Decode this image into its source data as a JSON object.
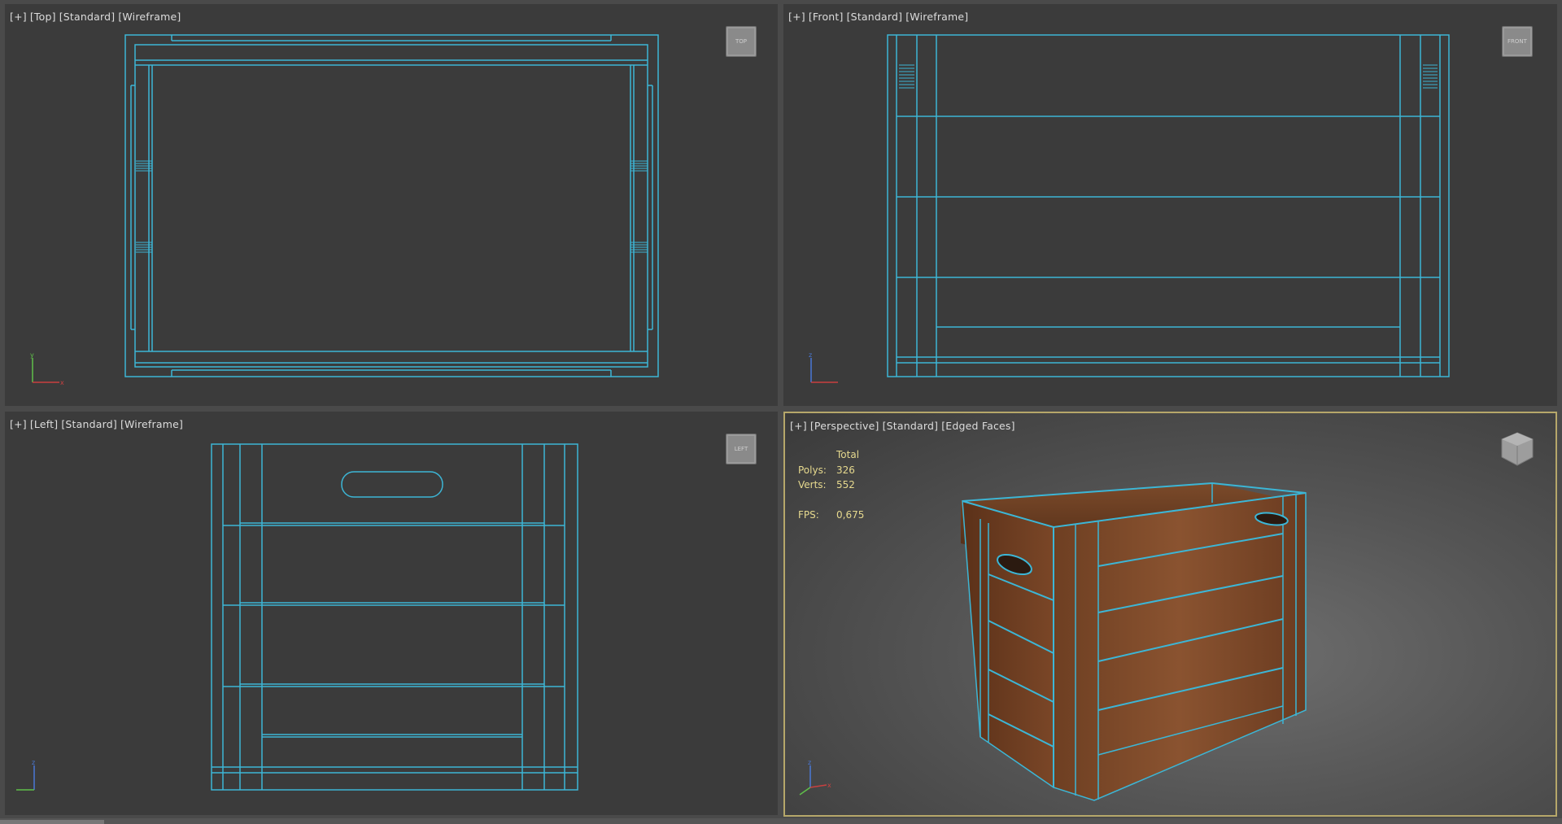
{
  "viewports": {
    "top": {
      "labels": [
        "[+]",
        "[Top]",
        "[Standard]",
        "[Wireframe]"
      ],
      "cube": "TOP"
    },
    "front": {
      "labels": [
        "[+]",
        "[Front]",
        "[Standard]",
        "[Wireframe]"
      ],
      "cube": "FRONT"
    },
    "left": {
      "labels": [
        "[+]",
        "[Left]",
        "[Standard]",
        "[Wireframe]"
      ],
      "cube": "LEFT"
    },
    "perspective": {
      "labels": [
        "[+]",
        "[Perspective]",
        "[Standard]",
        "[Edged Faces]"
      ]
    }
  },
  "stats": {
    "header": "Total",
    "polys_label": "Polys:",
    "polys": "326",
    "verts_label": "Verts:",
    "verts": "552",
    "fps_label": "FPS:",
    "fps": "0,675"
  },
  "colors": {
    "wire": "#3cb6d6",
    "viewport_bg": "#3b3b3b",
    "active_border": "#b6a76a",
    "stats_text": "#e6d98e"
  }
}
